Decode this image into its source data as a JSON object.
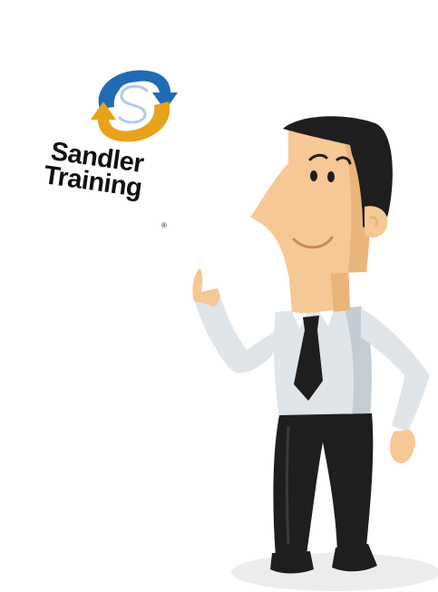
{
  "logo": {
    "line1": "Sandler",
    "line2": "Training",
    "registered": "®",
    "icon": "sandler-s-arrows-icon",
    "colors": {
      "blue": "#1f6bb5",
      "orange": "#e8a21c"
    }
  },
  "illustration": {
    "subject": "cartoon-businessman-waving",
    "colors": {
      "skin": "#f5c895",
      "skin_shade": "#eab57a",
      "hair": "#1e1e1e",
      "shirt": "#dfe5e8",
      "shirt_shade": "#c4cdd2",
      "tie": "#1e1e1e",
      "pants": "#1e1e1e",
      "shadow": "#ececec"
    }
  }
}
